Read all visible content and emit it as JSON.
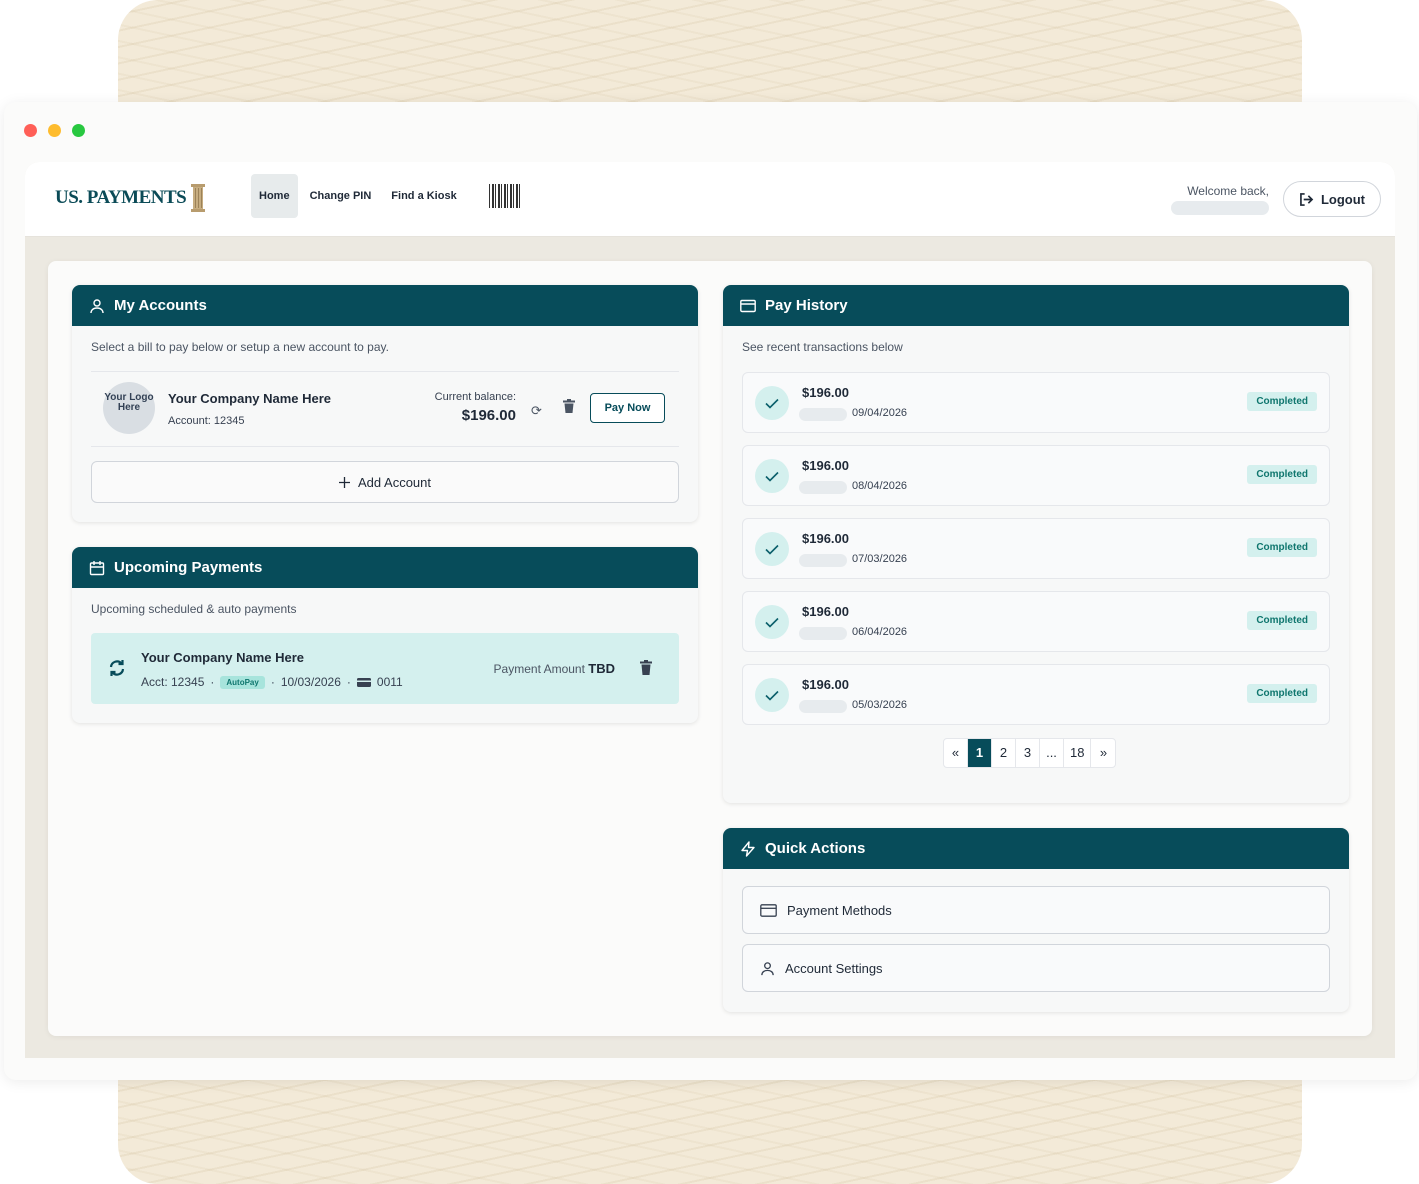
{
  "nav": {
    "brand": "US. PAYMENTS",
    "items": [
      "Home",
      "Change PIN",
      "Find a Kiosk"
    ],
    "active": "Home",
    "welcome": "Welcome back,",
    "logout": "Logout"
  },
  "accounts": {
    "title": "My Accounts",
    "subtitle": "Select a bill to pay below or setup a new account to pay.",
    "logo_placeholder": "Your Logo Here",
    "company": "Your Company Name Here",
    "account": "Account: 12345",
    "balance_label": "Current balance:",
    "balance": "$196.00",
    "pay_now": "Pay Now",
    "add_account": "Add Account"
  },
  "upcoming": {
    "title": "Upcoming Payments",
    "subtitle": "Upcoming scheduled & auto payments",
    "company": "Your Company Name Here",
    "acct": "Acct: 12345",
    "badge": "AutoPay",
    "date": "10/03/2026",
    "card": "0011",
    "amount_label": "Payment Amount",
    "amount": "TBD"
  },
  "history": {
    "title": "Pay History",
    "subtitle": "See recent transactions below",
    "items": [
      {
        "amount": "$196.00",
        "date": "09/04/2026",
        "status": "Completed"
      },
      {
        "amount": "$196.00",
        "date": "08/04/2026",
        "status": "Completed"
      },
      {
        "amount": "$196.00",
        "date": "07/03/2026",
        "status": "Completed"
      },
      {
        "amount": "$196.00",
        "date": "06/04/2026",
        "status": "Completed"
      },
      {
        "amount": "$196.00",
        "date": "05/03/2026",
        "status": "Completed"
      }
    ],
    "pagination": [
      "«",
      "1",
      "2",
      "3",
      "...",
      "18",
      "»"
    ],
    "current_page": "1"
  },
  "quick": {
    "title": "Quick Actions",
    "payment_methods": "Payment Methods",
    "account_settings": "Account Settings"
  },
  "colors": {
    "primary": "#074c5a",
    "accent_light": "#d4f0ee",
    "success_text": "#0f766e"
  }
}
